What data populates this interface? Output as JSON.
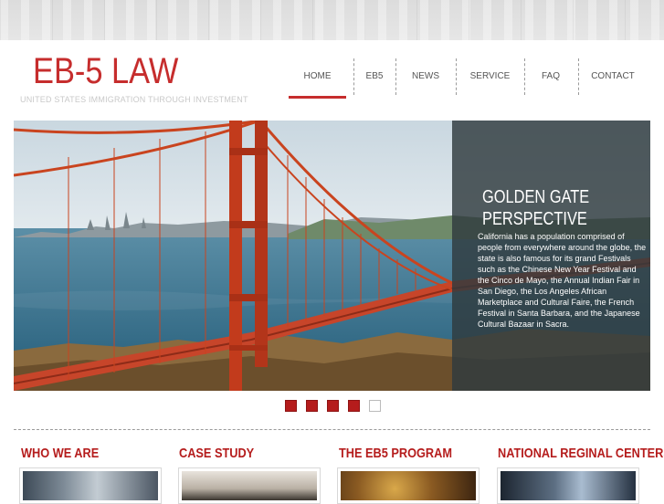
{
  "header": {
    "logo_title": "EB-5 LAW",
    "logo_tagline": "UNITED STATES IMMIGRATION THROUGH INVESTMENT"
  },
  "nav": {
    "items": [
      {
        "label": "HOME",
        "active": true
      },
      {
        "label": "EB5",
        "active": false
      },
      {
        "label": "NEWS",
        "active": false
      },
      {
        "label": "SERVICE",
        "active": false
      },
      {
        "label": "FAQ",
        "active": false
      },
      {
        "label": "CONTACT",
        "active": false
      }
    ]
  },
  "hero": {
    "caption_title_line1": "GOLDEN GATE",
    "caption_title_line2": "PERSPECTIVE",
    "caption_text": "California has a population comprised of people from everywhere around the globe, the state is also famous for its grand Festivals such as the Chinese New Year Festival and the Cinco de Mayo, the Annual Indian Fair in San Diego, the Los Angeles African Marketplace and Cultural Faire, the French Festival in Santa Barbara, and the Japanese Cultural Bazaar in Sacra."
  },
  "slider": {
    "slide_count": 5,
    "active_slides": 4
  },
  "sections": [
    {
      "title": "WHO WE ARE"
    },
    {
      "title": "CASE STUDY"
    },
    {
      "title": "THE EB5 PROGRAM"
    },
    {
      "title": "NATIONAL REGINAL CENTERS"
    }
  ],
  "colors": {
    "accent": "#c62d2d",
    "caption_bg": "#303a3e"
  }
}
